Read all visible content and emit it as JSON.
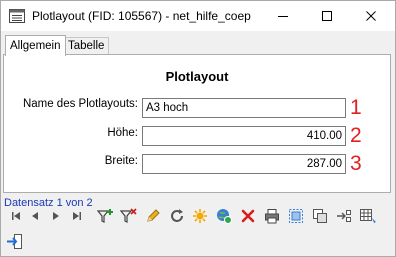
{
  "window": {
    "title": "Plotlayout (FID: 105567) - net_hilfe_coep",
    "controls": [
      "minimize-icon",
      "maximize-icon",
      "close-icon"
    ]
  },
  "tabs": [
    {
      "label": "Allgemein",
      "active": true
    },
    {
      "label": "Tabelle",
      "active": false
    }
  ],
  "form": {
    "heading": "Plotlayout",
    "fields": [
      {
        "label": "Name des Plotlayouts:",
        "value": "A3 hoch",
        "marker": "1"
      },
      {
        "label": "Höhe:",
        "value": "410.00",
        "marker": "2"
      },
      {
        "label": "Breite:",
        "value": "287.00",
        "marker": "3"
      }
    ]
  },
  "status": "Datensatz 1 von 2",
  "toolbar": {
    "icons": [
      "first-record-icon",
      "previous-record-icon",
      "next-record-icon",
      "last-record-icon",
      "add-filter-icon",
      "remove-filter-icon",
      "edit-icon",
      "refresh-icon",
      "highlight-icon",
      "globe-icon",
      "delete-icon",
      "print-icon",
      "select-area-icon",
      "copy-icon",
      "move-icon",
      "table-icon"
    ],
    "exit_icon": "exit-icon"
  },
  "colors": {
    "marker": "#e02020",
    "status": "#1a38b8",
    "accent": "#1e6fd0"
  }
}
